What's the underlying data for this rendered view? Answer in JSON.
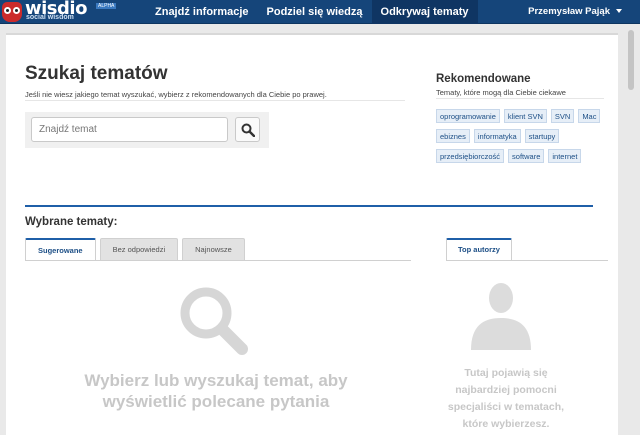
{
  "brand": {
    "name": "wisdio",
    "tagline": "social wisdom",
    "badge": "ALPHA"
  },
  "nav": {
    "items": [
      {
        "label": "Znajdź informacje",
        "active": false
      },
      {
        "label": "Podziel się wiedzą",
        "active": false
      },
      {
        "label": "Odkrywaj tematy",
        "active": true
      }
    ],
    "user_name": "Przemysław Pająk"
  },
  "search": {
    "title": "Szukaj tematów",
    "subtitle": "Jeśli nie wiesz jakiego temat wyszukać, wybierz z rekomendowanych dla Ciebie po prawej.",
    "placeholder": "Znajdź temat",
    "value": "",
    "button_icon": "search-icon"
  },
  "recommended": {
    "title": "Rekomendowane",
    "subtitle": "Tematy, które mogą dla Ciebie ciekawe",
    "tags": [
      "oprogramowanie",
      "klient SVN",
      "SVN",
      "Mac",
      "ebiznes",
      "informatyka",
      "startupy",
      "przedsiębiorczość",
      "software",
      "internet"
    ]
  },
  "chosen": {
    "title": "Wybrane tematy:",
    "tabs": [
      {
        "label": "Sugerowane",
        "active": true
      },
      {
        "label": "Bez odpowiedzi",
        "active": false
      },
      {
        "label": "Najnowsze",
        "active": false
      }
    ],
    "empty_icon": "search-icon",
    "empty_line1": "Wybierz lub wyszukaj temat, aby",
    "empty_line2": "wyświetlić polecane pytania"
  },
  "authors": {
    "tab_label": "Top autorzy",
    "empty_icon": "person-icon",
    "empty_line1": "Tutaj pojawią się",
    "empty_line2": "najbardziej pomocni",
    "empty_line3": "specjaliści w tematach,",
    "empty_line4": "które wybierzesz."
  },
  "colors": {
    "nav_bg": "#15457a",
    "nav_active": "#0f3563",
    "accent": "#1f5fa8",
    "tag_bg": "#e6eef7",
    "muted_text": "#c7c7c7"
  }
}
